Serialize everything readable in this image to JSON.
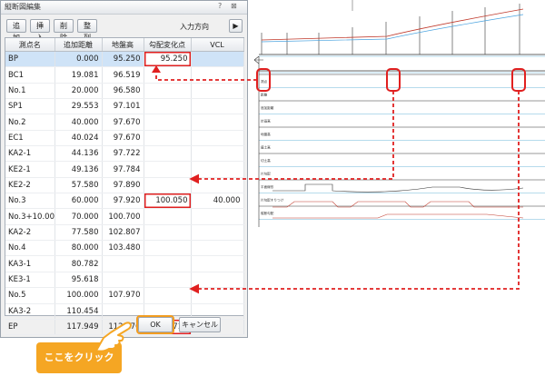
{
  "dialog": {
    "title": "縦断図編集",
    "title_buttons": [
      "?",
      "⊠"
    ],
    "toolbar": {
      "add_label": "追加",
      "insert_label": "挿入",
      "delete_label": "削除",
      "sort_label": "整列",
      "direction_label": "入力方向",
      "direction_icon": "play-arrow-icon"
    },
    "columns": [
      "測点名",
      "追加距離",
      "地盤高",
      "勾配変化点",
      "VCL"
    ],
    "rows": [
      {
        "name": "BP",
        "dist": "0.000",
        "ground": "95.250",
        "vip": "95.250",
        "vcl": ""
      },
      {
        "name": "BC1",
        "dist": "19.081",
        "ground": "96.519",
        "vip": "",
        "vcl": ""
      },
      {
        "name": "No.1",
        "dist": "20.000",
        "ground": "96.580",
        "vip": "",
        "vcl": ""
      },
      {
        "name": "SP1",
        "dist": "29.553",
        "ground": "97.101",
        "vip": "",
        "vcl": ""
      },
      {
        "name": "No.2",
        "dist": "40.000",
        "ground": "97.670",
        "vip": "",
        "vcl": ""
      },
      {
        "name": "EC1",
        "dist": "40.024",
        "ground": "97.670",
        "vip": "",
        "vcl": ""
      },
      {
        "name": "KA2-1",
        "dist": "44.136",
        "ground": "97.722",
        "vip": "",
        "vcl": ""
      },
      {
        "name": "KE2-1",
        "dist": "49.136",
        "ground": "97.784",
        "vip": "",
        "vcl": ""
      },
      {
        "name": "KE2-2",
        "dist": "57.580",
        "ground": "97.890",
        "vip": "",
        "vcl": ""
      },
      {
        "name": "No.3",
        "dist": "60.000",
        "ground": "97.920",
        "vip": "100.050",
        "vcl": "40.000"
      },
      {
        "name": "No.3+10.00",
        "dist": "70.000",
        "ground": "100.700",
        "vip": "",
        "vcl": ""
      },
      {
        "name": "KA2-2",
        "dist": "77.580",
        "ground": "102.807",
        "vip": "",
        "vcl": ""
      },
      {
        "name": "No.4",
        "dist": "80.000",
        "ground": "103.480",
        "vip": "",
        "vcl": ""
      },
      {
        "name": "KA3-1",
        "dist": "80.782",
        "ground": "",
        "vip": "",
        "vcl": ""
      },
      {
        "name": "KE3-1",
        "dist": "95.618",
        "ground": "",
        "vip": "",
        "vcl": ""
      },
      {
        "name": "No.5",
        "dist": "100.000",
        "ground": "107.970",
        "vip": "",
        "vcl": ""
      },
      {
        "name": "KA3-2",
        "dist": "110.454",
        "ground": "",
        "vip": "",
        "vcl": ""
      },
      {
        "name": "EP",
        "dist": "117.949",
        "ground": "112.370",
        "vip": "106.710",
        "vcl": ""
      }
    ],
    "selected_row": 0,
    "ok_label": "OK",
    "cancel_label": "キャンセル"
  },
  "callout": {
    "text": "ここをクリック",
    "color": "#f5a623"
  },
  "annotation_color": "#e02020",
  "drawing": {
    "row_labels": [
      "測点",
      "距離",
      "追加距離",
      "計画高",
      "地盤高",
      "盛土高",
      "切土高",
      "片勾配",
      "平面線形",
      "片勾配すりつけ",
      "縦断勾配"
    ]
  }
}
